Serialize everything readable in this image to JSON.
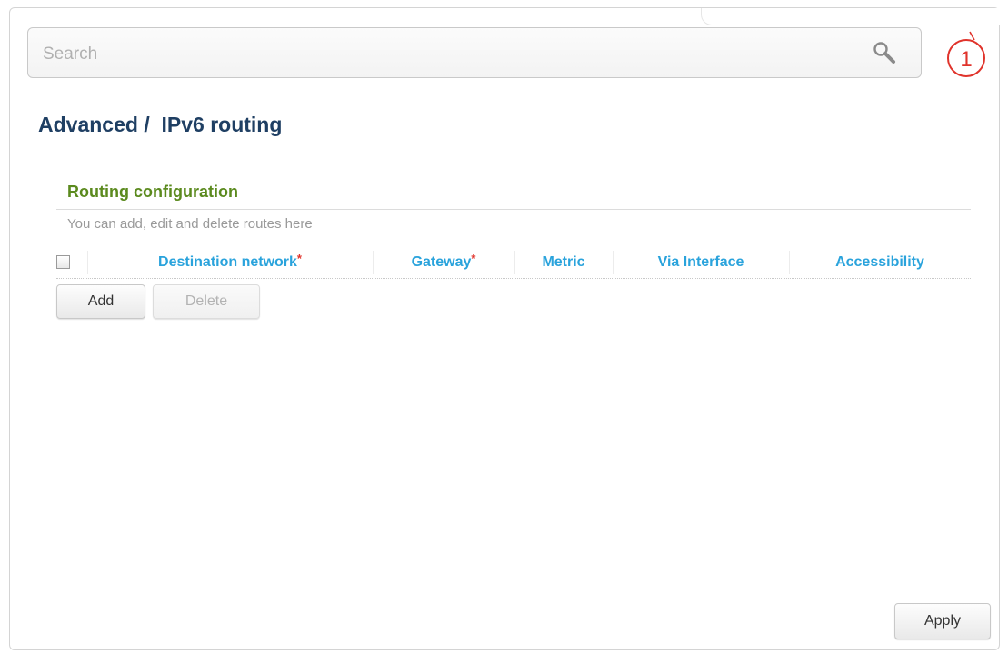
{
  "search": {
    "placeholder": "Search"
  },
  "badge": {
    "number": "1",
    "color": "#e0332b"
  },
  "page": {
    "title": "Advanced /  IPv6 routing"
  },
  "section": {
    "title": "Routing configuration",
    "description": "You can add, edit and delete routes here"
  },
  "table": {
    "columns": [
      {
        "label": "Destination network",
        "required": true
      },
      {
        "label": "Gateway",
        "required": true
      },
      {
        "label": "Metric",
        "required": false
      },
      {
        "label": "Via Interface",
        "required": false
      },
      {
        "label": "Accessibility",
        "required": false
      }
    ],
    "required_mark": "*",
    "rows": []
  },
  "buttons": {
    "add": "Add",
    "delete": "Delete",
    "apply": "Apply"
  },
  "colors": {
    "title": "#1f3f63",
    "section_title": "#5b8a1e",
    "column_header": "#2aa3dc",
    "required": "#e0332b"
  },
  "icons": {
    "search": "search-icon",
    "badge": "numbered-badge-icon"
  }
}
